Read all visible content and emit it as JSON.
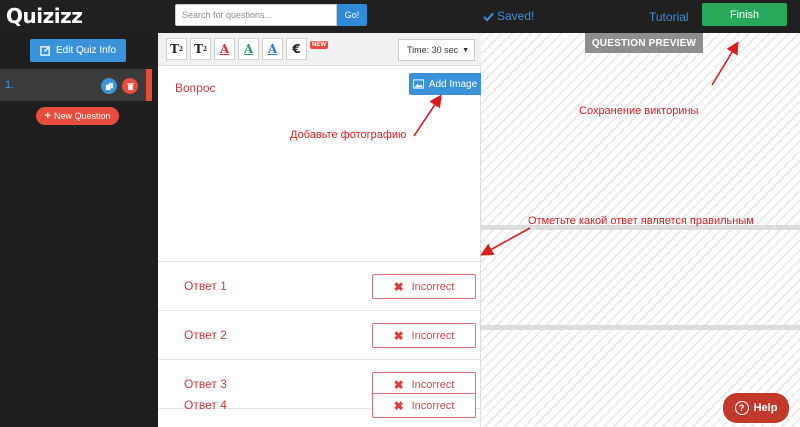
{
  "topbar": {
    "logo": "Quizizz",
    "search_placeholder": "Search for questions...",
    "search_button": "Go!",
    "saved_status": "Saved!",
    "tutorial_link": "Tutorial",
    "finish_button": "Finish"
  },
  "sidebar": {
    "edit_info_button": "Edit Quiz Info",
    "questions": [
      {
        "number": "1."
      }
    ],
    "new_question_button": "New Question"
  },
  "toolbar": {
    "superscript": "T",
    "subscript": "T",
    "color_a_1": "A",
    "color_a_2": "A",
    "color_a_3": "A",
    "currency": "€",
    "new_badge": "NEW",
    "time_select": "Time: 30 sec"
  },
  "question": {
    "text": "Вопрос",
    "add_image_button": "Add Image"
  },
  "answers": [
    {
      "text": "Ответ 1",
      "status": "Incorrect"
    },
    {
      "text": "Ответ 2",
      "status": "Incorrect"
    },
    {
      "text": "Ответ 3",
      "status": "Incorrect"
    },
    {
      "text": "Ответ 4",
      "status": "Incorrect"
    }
  ],
  "preview": {
    "label": "QUESTION PREVIEW",
    "help_button": "Help"
  },
  "annotations": {
    "add_photo": "Добавьте фотографию",
    "save_quiz": "Сохранение викторины",
    "mark_correct": "Отметьте какой ответ является правильным"
  },
  "colors": {
    "topbar_bg": "#202020",
    "accent_blue": "#3a93d8",
    "finish_green": "#28a85a",
    "danger_red": "#e74c3c",
    "annotation_red": "#d81e1e"
  }
}
